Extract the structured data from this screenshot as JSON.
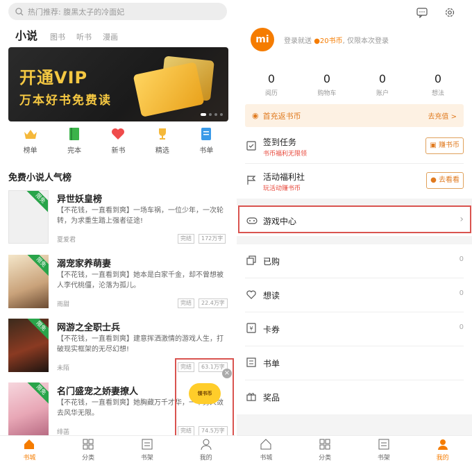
{
  "left": {
    "search_placeholder": "热门推荐: 腹黑太子的冷面妃",
    "categories": [
      "小说",
      "图书",
      "听书",
      "漫画"
    ],
    "banner": {
      "line1": "开通VIP",
      "line2": "万本好书免费读"
    },
    "quick": [
      {
        "label": "榜单",
        "icon": "crown-icon",
        "color": "#f5b83a"
      },
      {
        "label": "完本",
        "icon": "book-icon",
        "color": "#3bb34a"
      },
      {
        "label": "新书",
        "icon": "heart-icon",
        "color": "#ef4b4b"
      },
      {
        "label": "精选",
        "icon": "trophy-icon",
        "color": "#f5b83a"
      },
      {
        "label": "书单",
        "icon": "list-icon",
        "color": "#3a9ae8"
      }
    ],
    "section_title": "免费小说人气榜",
    "books": [
      {
        "title": "异世妖皇榜",
        "desc": "【不花钱，一直看到爽】一场车祸，一位少年，一次轮转，为求重生踏上强者征途!",
        "author": "夏爱君",
        "status": "完结",
        "words": "172万字",
        "flag": "限免"
      },
      {
        "title": "溺宠家养萌妻",
        "desc": "【不花钱，一直看到爽】她本是白家千金，却不曾想被人李代桃僵，沦落为孤儿。",
        "author": "雨甜",
        "status": "完结",
        "words": "22.4万字",
        "flag": "限免"
      },
      {
        "title": "网游之全职士兵",
        "desc": "【不花钱，一直看到爽】建意挥洒激情的游戏人生，打破现实框架的无尽幻想!",
        "author": "未陌",
        "status": "完结",
        "words": "63.1万字",
        "flag": "限免"
      },
      {
        "title": "名门盛宠之娇妻撩人",
        "desc": "【不花钱，一直看到爽】她胸藏万千才华，一个男人敛去风华无限。",
        "author": "绯菡",
        "status": "完结",
        "words": "74.5万字",
        "flag": "限免"
      }
    ],
    "float_ad": "领书币",
    "tabs": [
      {
        "label": "书城",
        "icon": "home-icon"
      },
      {
        "label": "分类",
        "icon": "grid-icon"
      },
      {
        "label": "书架",
        "icon": "bookshelf-icon"
      },
      {
        "label": "我的",
        "icon": "person-icon"
      }
    ]
  },
  "right": {
    "logo": "mi",
    "login_text_pre": "登录就送",
    "login_coin": "20书币",
    "login_text_post": ", 仅限本次登录",
    "stats": [
      {
        "value": "0",
        "label": "阅历"
      },
      {
        "value": "0",
        "label": "购物车"
      },
      {
        "value": "0",
        "label": "账户"
      },
      {
        "value": "0",
        "label": "想法"
      }
    ],
    "promo": {
      "left": "首充返书币",
      "right": "去充值 >"
    },
    "tasks": [
      {
        "title": "签到任务",
        "sub": "书币福利无限领",
        "button": "赚书币"
      },
      {
        "title": "活动福利社",
        "sub": "玩活动赚书币",
        "button": "去看看"
      }
    ],
    "game_center": "游戏中心",
    "menu": [
      {
        "label": "已购",
        "value": "0"
      },
      {
        "label": "想读",
        "value": "0"
      },
      {
        "label": "卡券",
        "value": "0"
      },
      {
        "label": "书单",
        "value": ""
      },
      {
        "label": "奖品",
        "value": ""
      }
    ],
    "tabs": [
      {
        "label": "书城",
        "icon": "home-icon"
      },
      {
        "label": "分类",
        "icon": "grid-icon"
      },
      {
        "label": "书架",
        "icon": "bookshelf-icon"
      },
      {
        "label": "我的",
        "icon": "person-icon"
      }
    ]
  }
}
